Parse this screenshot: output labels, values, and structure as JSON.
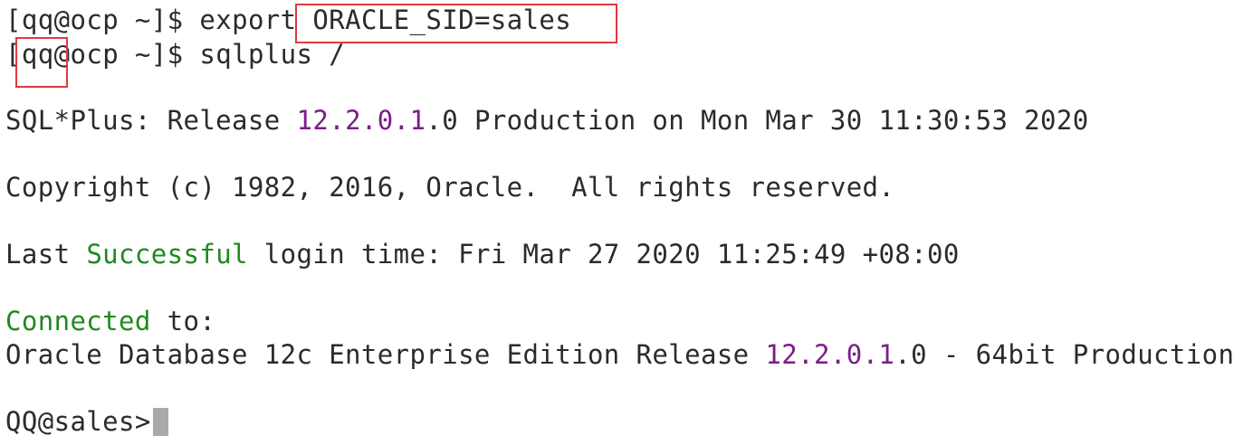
{
  "terminal": {
    "line1": {
      "open": "[",
      "user": "qq",
      "at": "@",
      "host_dir": "ocp ~]$ export ",
      "assignment": "ORACLE_SID=sales"
    },
    "line2": {
      "open": "[",
      "user": "qq",
      "at": "@",
      "host_dir": "ocp ~]$ sqlplus /"
    },
    "line3": {
      "prefix": "SQL*Plus: Release ",
      "version_colored": "12.2.0.1",
      "version_rest": ".0 Production on Mon Mar 30 11:30:53 2020"
    },
    "line4": {
      "text": "Copyright (c) 1982, 2016, Oracle.  All rights reserved."
    },
    "line5": {
      "prefix": "Last ",
      "status": "Successful",
      "suffix": " login time: Fri Mar 27 2020 11:25:49 +08:00"
    },
    "line6": {
      "status": "Connected",
      "suffix": " to:"
    },
    "line7": {
      "prefix": "Oracle Database 12c Enterprise Edition Release ",
      "version_colored": "12.2.0.1",
      "version_rest": ".0 - 64bit Production"
    },
    "prompt": {
      "text": "QQ@sales>"
    }
  },
  "colors": {
    "background": "#ffffff",
    "text": "#2b2b2b",
    "number": "#7a1e86",
    "success": "#1f8a1f",
    "highlight_box": "#e0393e",
    "cursor": "#a9a9a9"
  }
}
